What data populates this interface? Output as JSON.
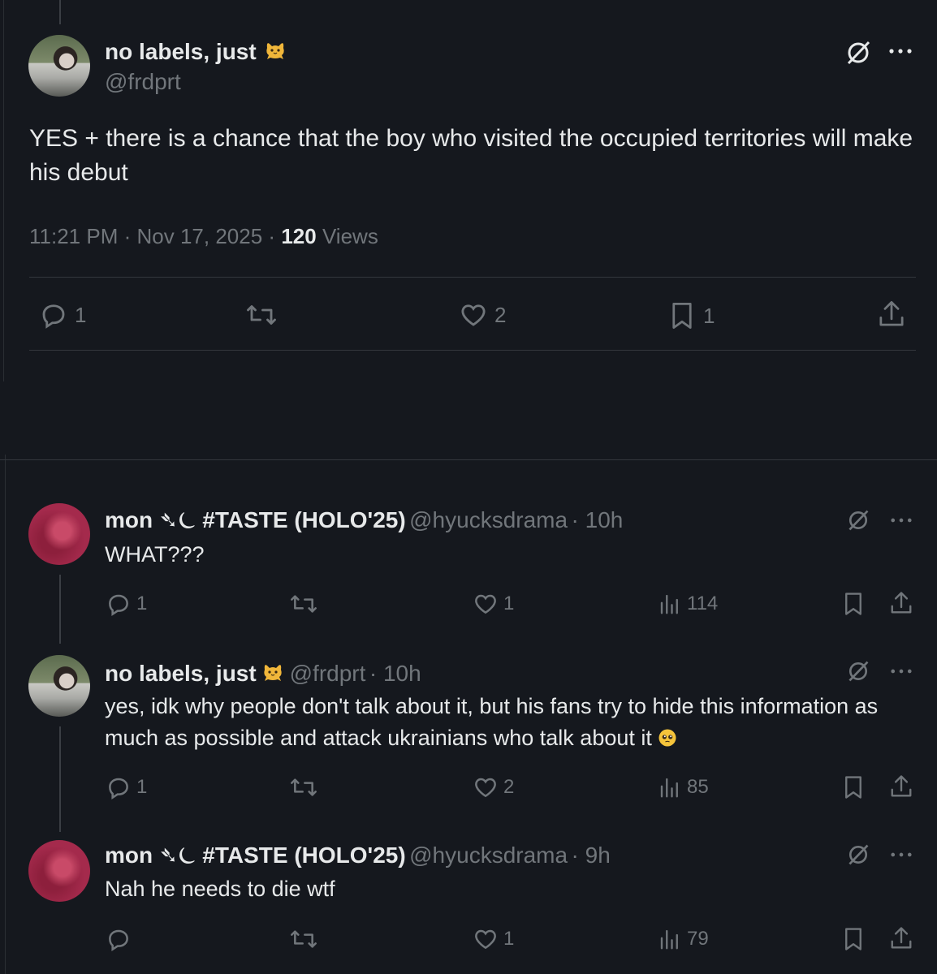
{
  "main_tweet": {
    "display_name": "no labels, just",
    "name_emoji": "cat-emoji",
    "handle": "@frdprt",
    "text": "YES + there is a chance that the boy who visited the occupied territories will make his debut",
    "time": "11:21 PM",
    "date": "Nov 17, 2025",
    "views_count": "120",
    "views_label": "Views",
    "separator": "·",
    "actions": {
      "replies": "1",
      "retweets": "",
      "likes": "2",
      "bookmarks": "1"
    }
  },
  "replies": [
    {
      "display_name": "mon ➴⏾ #TASTE (HOLO'25)",
      "handle": "@hyucksdrama",
      "time": "· 10h",
      "text": "WHAT???",
      "actions": {
        "replies": "1",
        "likes": "1",
        "views": "114"
      }
    },
    {
      "display_name": "no labels, just",
      "name_emoji": "cat-emoji",
      "handle": "@frdprt",
      "time": "· 10h",
      "text": "yes, idk why people don't talk about it, but his fans try to hide this information as much as possible and attack ukrainians who talk about it",
      "text_emoji": "pleading-face-emoji",
      "actions": {
        "replies": "1",
        "likes": "2",
        "views": "85"
      }
    },
    {
      "display_name": "mon ➴⏾ #TASTE (HOLO'25)",
      "handle": "@hyucksdrama",
      "time": "· 9h",
      "text": "Nah he needs to die wtf",
      "actions": {
        "replies": "",
        "likes": "1",
        "views": "79"
      }
    }
  ],
  "colors": {
    "background": "#15181e",
    "text": "#e7e9ea",
    "muted": "#71767b",
    "divider": "#33373d"
  },
  "icons": [
    "grok-icon",
    "more-icon",
    "reply-icon",
    "retweet-icon",
    "like-icon",
    "bookmark-icon",
    "share-icon",
    "views-icon"
  ]
}
